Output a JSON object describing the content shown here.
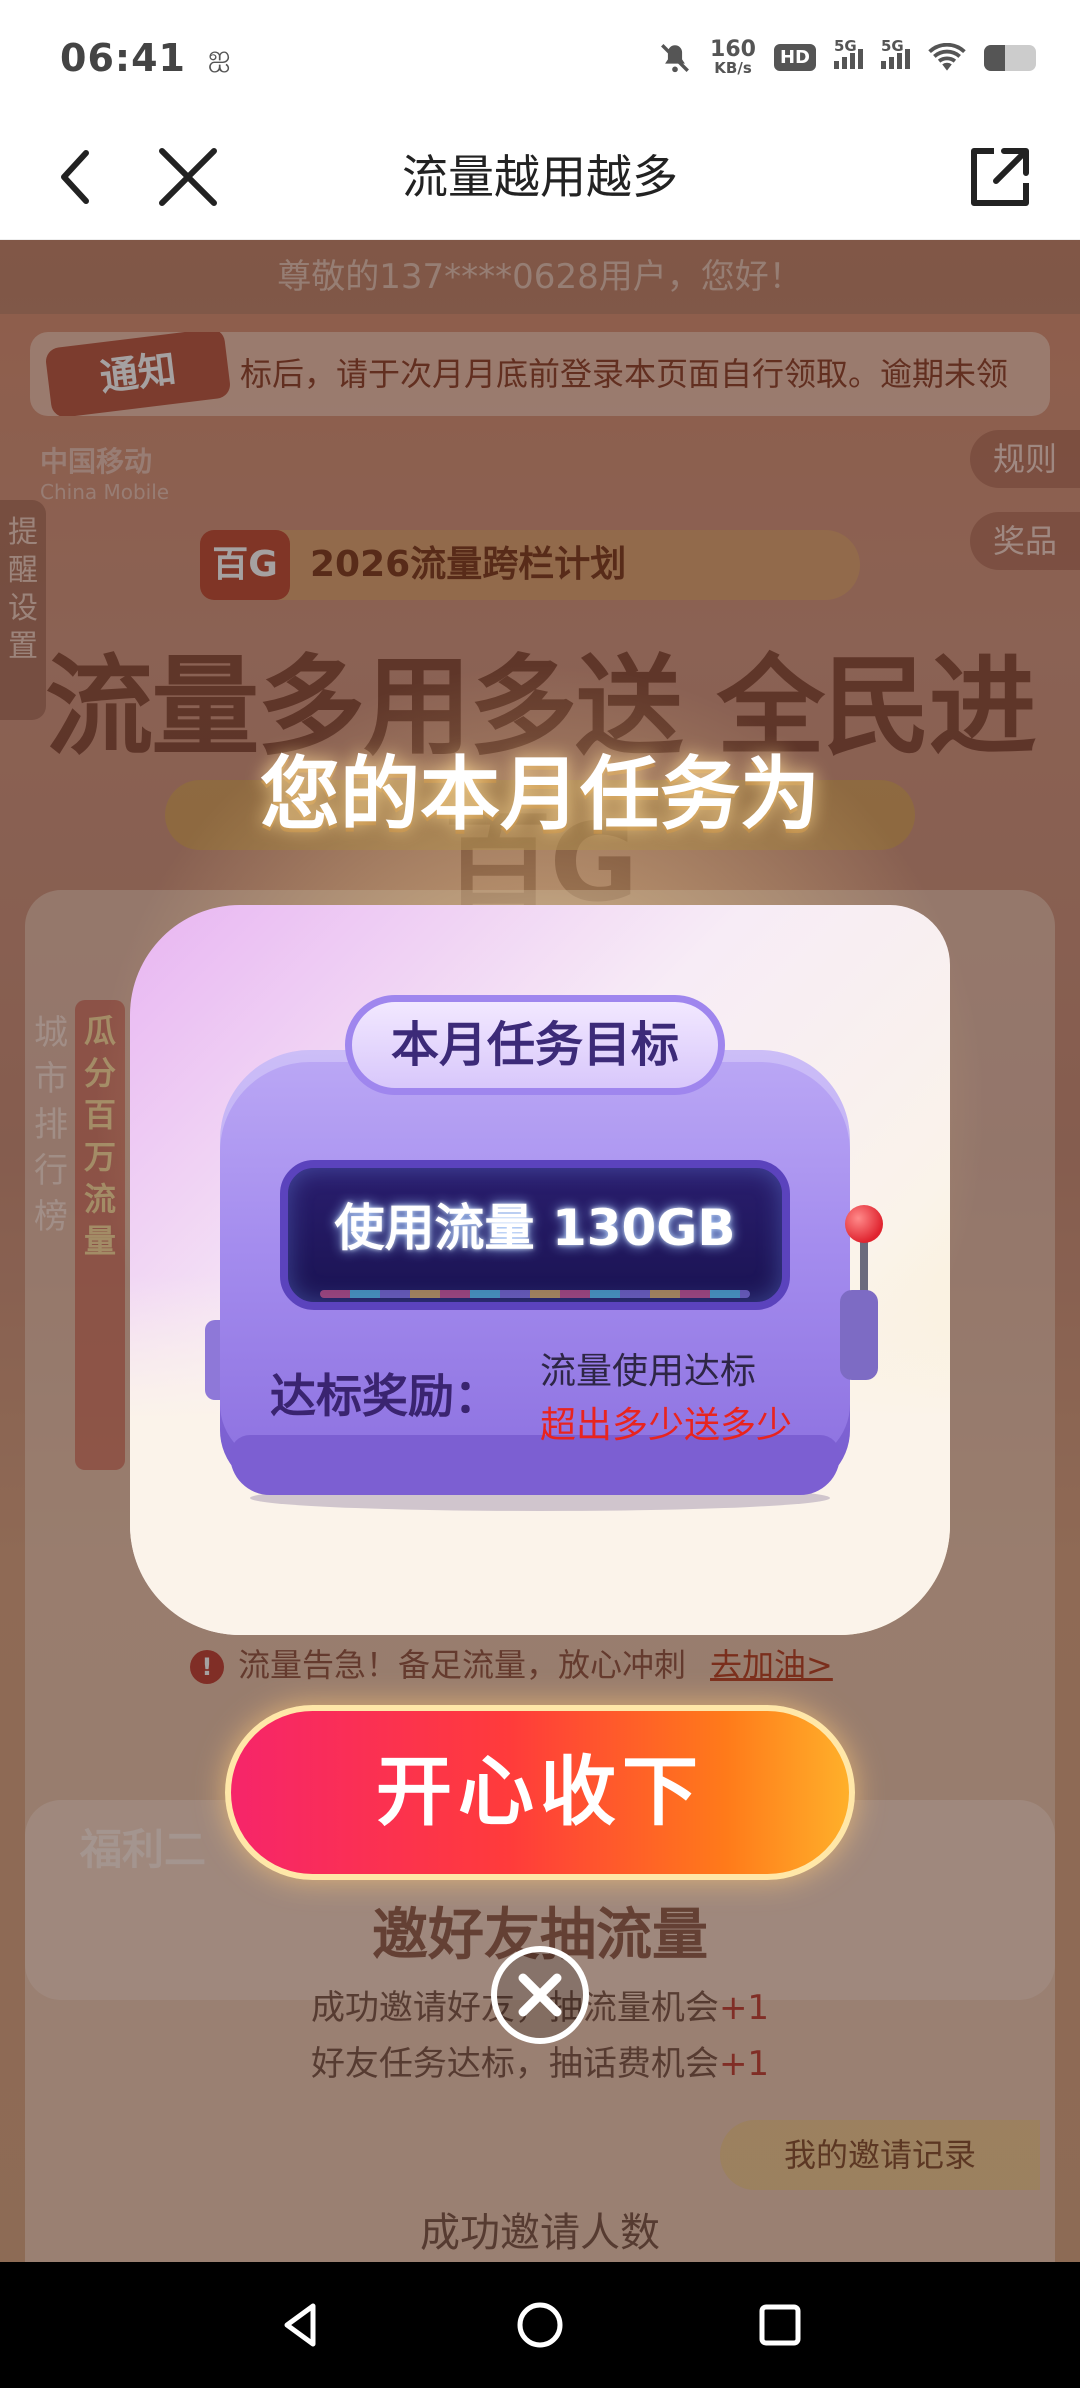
{
  "status_bar": {
    "time": "06:41",
    "speed_value": "160",
    "speed_unit": "KB/s",
    "hd_label": "HD",
    "sim1_label": "5G",
    "sim2_label": "5G",
    "icons": [
      "mute-icon",
      "hd-icon",
      "signal-icon",
      "wifi-icon",
      "battery-icon"
    ]
  },
  "nav": {
    "title": "流量越用越多"
  },
  "background_page": {
    "greeting": "尊敬的137****0628用户，您好！",
    "notice_tag": "通知",
    "notice_text": "标后，请于次月月底前登录本页面自行领取。逾期未领",
    "brand_cn": "中国移动",
    "brand_en": "China Mobile",
    "rules_label": "规则",
    "prizes_label": "奖品",
    "remind_label": "提醒设置",
    "plan_badge": "百G",
    "plan_title": "2026流量跨栏计划",
    "hero_title": "流量多用多送 全民进百G",
    "rank_label": "城市排行榜",
    "rank_label2": "瓜分百万流量",
    "warn_text": "流量告急！备足流量，放心冲刺",
    "warn_link": "去加油>",
    "welfare2": "福利二",
    "invite_title": "邀好友抽流量",
    "invite_line1": "成功邀请好友，抽流量机会",
    "invite_line2": "好友任务达标，抽话费机会",
    "plus_one": "+1",
    "invite_record": "我的邀请记录",
    "invite_count_label": "成功邀请人数"
  },
  "modal": {
    "heading": "您的本月任务为",
    "task_label": "本月任务目标",
    "screen_text": "使用流量 130GB",
    "reward_label": "达标奖励：",
    "reward_line1": "流量使用达标",
    "reward_line2": "超出多少送多少",
    "accept_button": "开心收下"
  },
  "colors": {
    "cta_start": "#f6256a",
    "cta_end": "#ffb02a",
    "machine": "#a48cee",
    "reward_highlight": "#e8241f"
  }
}
